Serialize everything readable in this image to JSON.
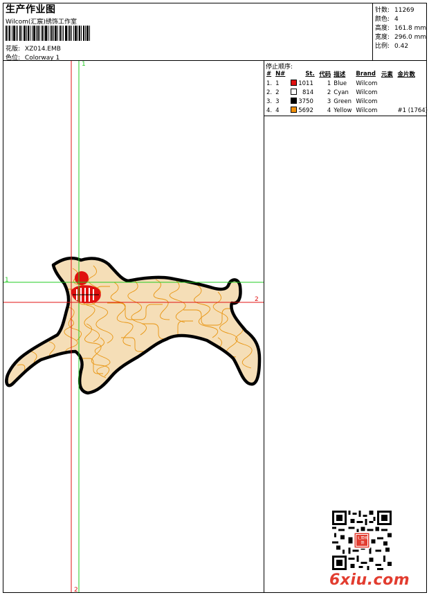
{
  "header": {
    "title": "生产作业图",
    "subtitle": "Wilcom(汇宸)绣饰工作室",
    "pattern_label": "花版:",
    "pattern_value": "XZ014.EMB",
    "colorway_label": "色位:",
    "colorway_value": "Colorway 1"
  },
  "stats": [
    {
      "label": "针数:",
      "value": "11269"
    },
    {
      "label": "颜色:",
      "value": "4"
    },
    {
      "label": "高度:",
      "value": "161.8 mm"
    },
    {
      "label": "宽度:",
      "value": "296.0 mm"
    },
    {
      "label": "比例:",
      "value": "0.42"
    }
  ],
  "stop_sequence": {
    "title": "停止顺序:",
    "columns": [
      "#",
      "N#",
      "St.",
      "代码",
      "描述",
      "Brand",
      "元素",
      "金片数"
    ],
    "rows": [
      {
        "idx": "1.",
        "n": "1",
        "color": "#e01010",
        "st": "1011",
        "code": "1",
        "desc": "Blue",
        "brand": "Wilcom",
        "element": "",
        "sequin": ""
      },
      {
        "idx": "2.",
        "n": "2",
        "color": "#ffffff",
        "st": "814",
        "code": "2",
        "desc": "Cyan",
        "brand": "Wilcom",
        "element": "",
        "sequin": ""
      },
      {
        "idx": "3.",
        "n": "3",
        "color": "#000000",
        "st": "3750",
        "code": "3",
        "desc": "Green",
        "brand": "Wilcom",
        "element": "",
        "sequin": ""
      },
      {
        "idx": "4.",
        "n": "4",
        "color": "#f0900a",
        "st": "5692",
        "code": "4",
        "desc": "Yellow",
        "brand": "Wilcom",
        "element": "",
        "sequin": "#1 (1764)"
      }
    ]
  },
  "guides": {
    "green_v_label": "1",
    "green_h_label": "1",
    "red_h_label": "2",
    "red_v_label": "2",
    "green_color": "#22cc22",
    "red_color": "#e01010"
  },
  "watermark": {
    "text": "6xiu.com",
    "seal_text": "汇宸绣饰"
  },
  "colors": {
    "fill": "#f5deb7",
    "stitch": "#e8940f",
    "outline": "#000000",
    "eye": "#e01010"
  }
}
